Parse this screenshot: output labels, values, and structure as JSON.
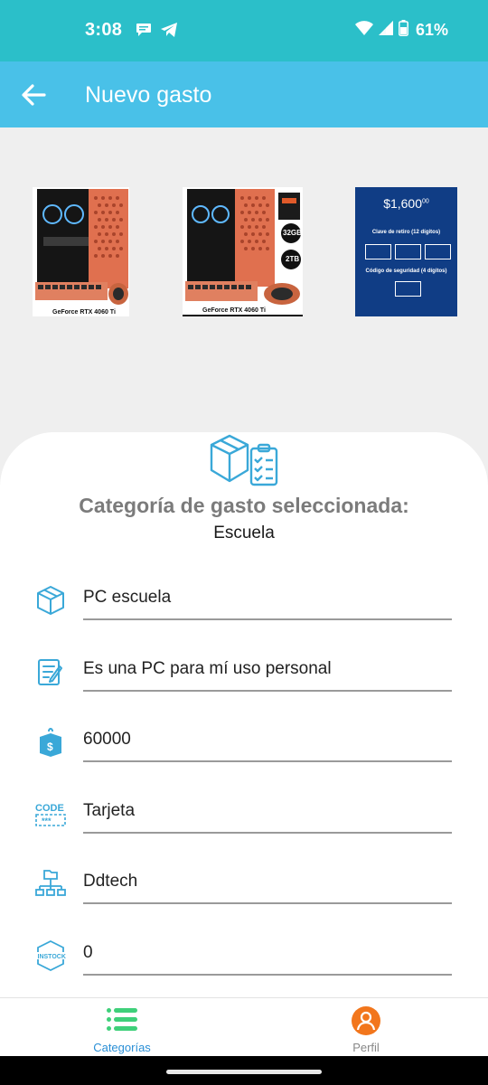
{
  "status_bar": {
    "time": "3:08",
    "battery": "61%",
    "icons": [
      "chat-icon",
      "telegram-icon",
      "wifi-icon",
      "signal-icon",
      "battery-icon"
    ]
  },
  "app_bar": {
    "title": "Nuevo gasto",
    "back_icon": "arrow-left-icon"
  },
  "gallery": {
    "images": [
      {
        "caption": "GeForce RTX 4060 Ti"
      },
      {
        "caption": "GeForce RTX 4060 Ti",
        "badges": [
          "32GB",
          "2TB"
        ]
      },
      {
        "price": "$1,600",
        "price_cents": "00",
        "line1": "Clave de retiro (12 dígitos)",
        "line2": "Código de seguridad (4 dígitos)"
      }
    ]
  },
  "category": {
    "title": "Categoría de gasto seleccionada:",
    "value": "Escuela"
  },
  "fields": [
    {
      "icon": "box-icon",
      "value": "PC escuela"
    },
    {
      "icon": "edit-note-icon",
      "value": "Es una PC para mí uso personal"
    },
    {
      "icon": "price-tag-icon",
      "value": "60000"
    },
    {
      "icon": "code-icon",
      "value": "Tarjeta"
    },
    {
      "icon": "hierarchy-icon",
      "value": "Ddtech"
    },
    {
      "icon": "in-stock-icon",
      "value": "0"
    }
  ],
  "bottom_nav": {
    "items": [
      {
        "label": "Categorías",
        "icon": "list-icon",
        "active": true
      },
      {
        "label": "Perfil",
        "icon": "person-icon",
        "active": false
      }
    ]
  },
  "colors": {
    "status_bar": "#2bbfc9",
    "app_bar": "#49c1e8",
    "accent": "#2a8fd6",
    "icon_blue": "#3aa8d8"
  }
}
